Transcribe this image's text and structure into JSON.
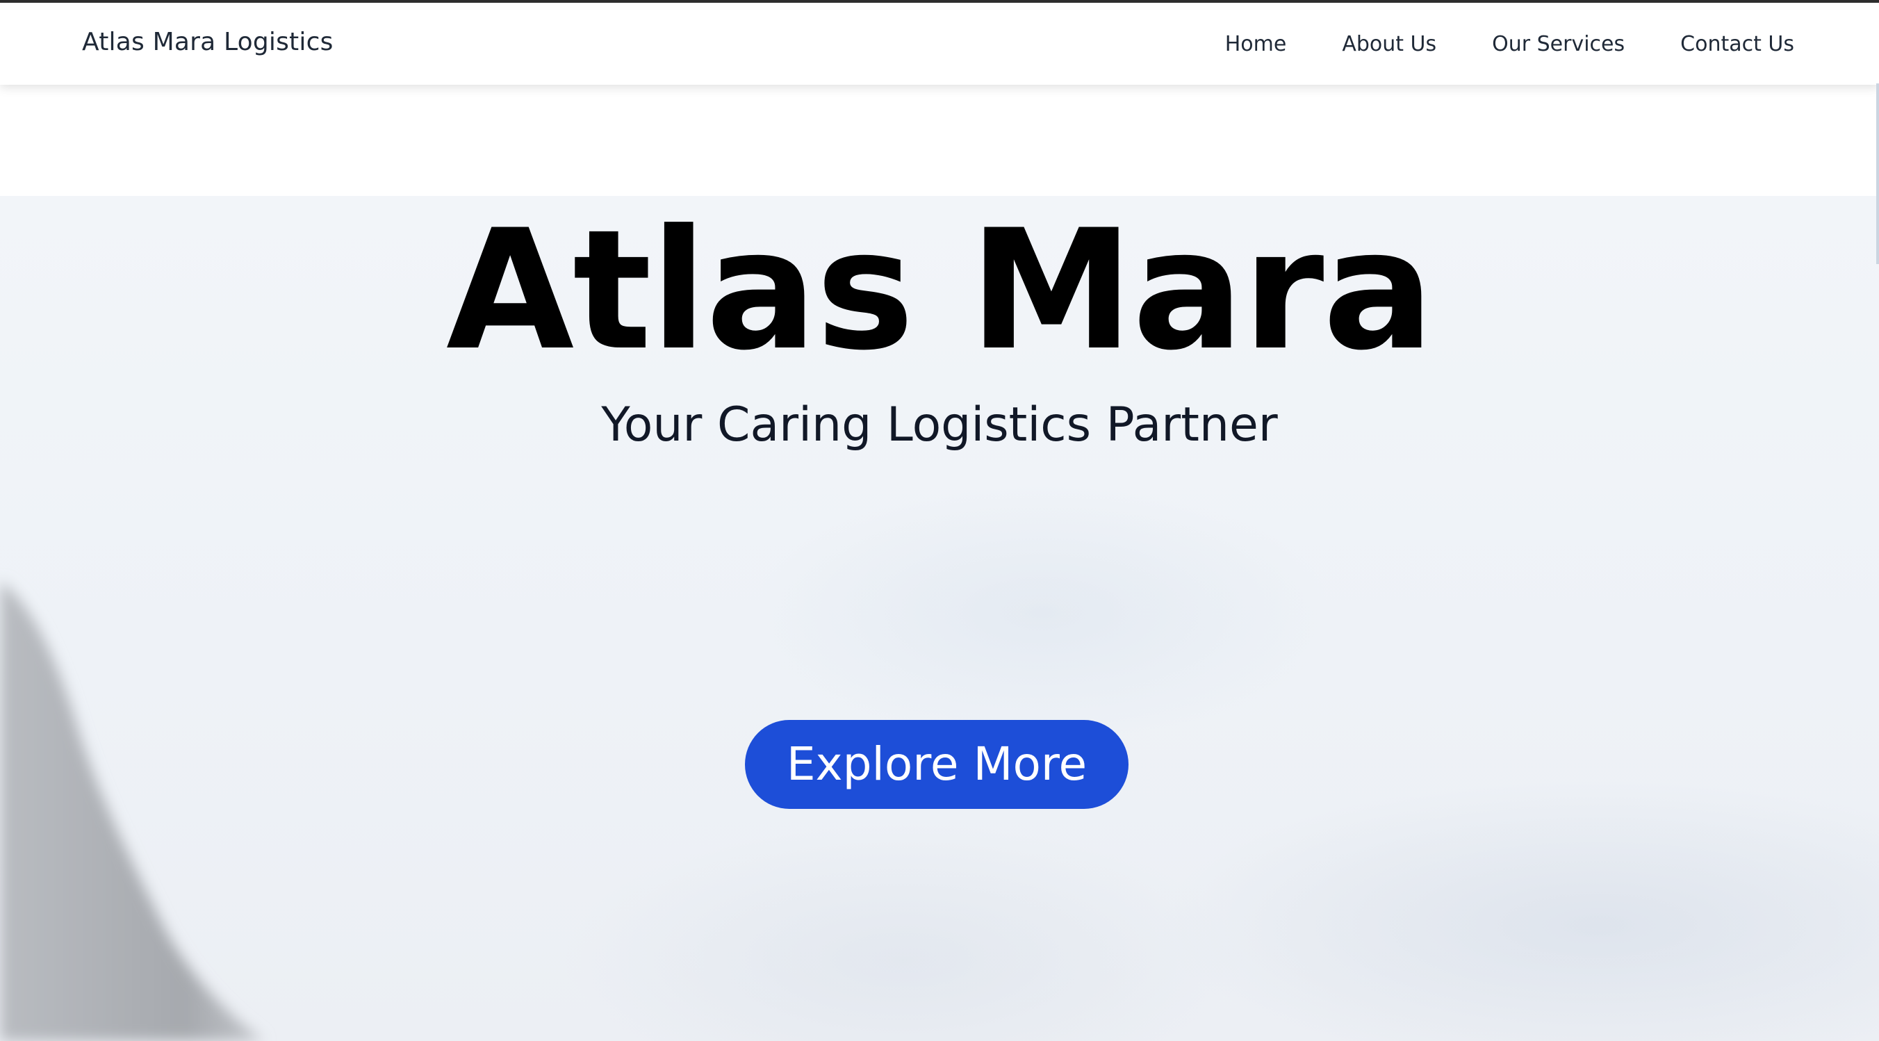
{
  "navbar": {
    "brand": "Atlas Mara Logistics",
    "links": [
      {
        "label": "Home"
      },
      {
        "label": "About Us"
      },
      {
        "label": "Our Services"
      },
      {
        "label": "Contact Us"
      }
    ]
  },
  "hero": {
    "title": "Atlas Mara",
    "subtitle": "Your Caring Logistics Partner",
    "cta_label": "Explore More"
  },
  "colors": {
    "cta_background": "#1d4ed8",
    "hero_background": "#eff3f8",
    "text_dark": "#1f2937"
  }
}
